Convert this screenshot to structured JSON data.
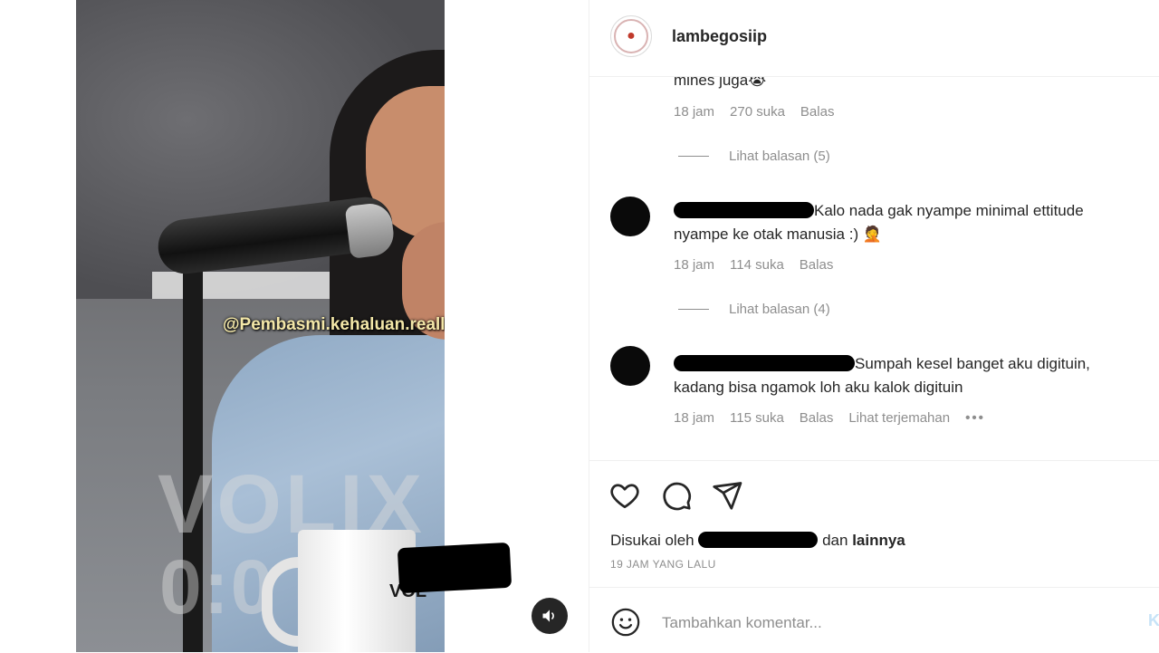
{
  "post": {
    "username": "lambegosiip",
    "video_watermark": "@Pembasmi.kehaluan.reall",
    "video_overlay_text": "VOLIX",
    "video_timer_text": "0:0  6:2",
    "mug_text": "VOL"
  },
  "comments": [
    {
      "text": "mines juga😭",
      "time": "18 jam",
      "likes": "270 suka",
      "reply_label": "Balas",
      "view_replies": "Lihat balasan (5)"
    },
    {
      "text": "Kalo nada gak nyampe minimal ettitude nyampe ke otak manusia :) 🤦",
      "time": "18 jam",
      "likes": "114 suka",
      "reply_label": "Balas",
      "view_replies": "Lihat balasan (4)"
    },
    {
      "text": "Sumpah kesel banget aku digituin, kadang bisa ngamok loh aku kalok digituin",
      "time": "18 jam",
      "likes": "115 suka",
      "reply_label": "Balas",
      "translate_label": "Lihat terjemahan",
      "more_label": "•••"
    }
  ],
  "footer": {
    "liked_by_prefix": "Disukai oleh",
    "liked_by_and": "dan",
    "liked_by_others": "lainnya",
    "time_ago": "19 JAM YANG LALU",
    "comment_placeholder": "Tambahkan komentar...",
    "post_label": "K"
  },
  "icons": {
    "like": "heart-icon",
    "comment": "comment-bubble-icon",
    "share": "paper-plane-icon",
    "emoji": "emoji-smile-icon",
    "sound": "speaker-icon"
  },
  "colors": {
    "text_primary": "#262626",
    "text_secondary": "#8e8e8e",
    "border": "#efefef",
    "post_button_disabled": "#c7e3f7"
  }
}
